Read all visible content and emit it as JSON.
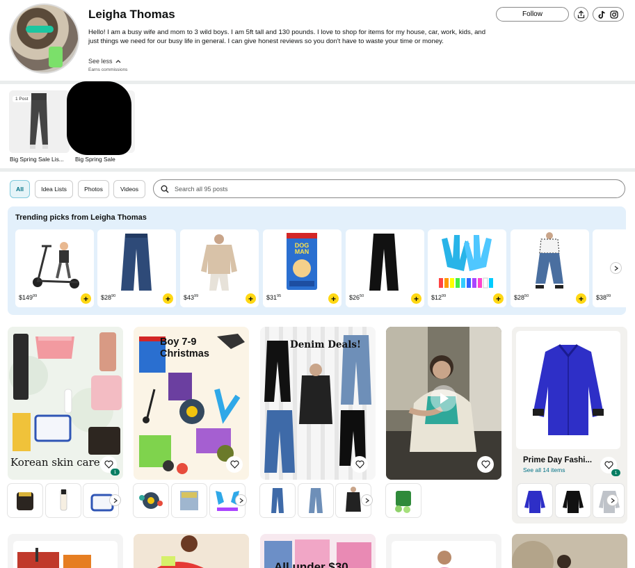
{
  "profile": {
    "name": "Leigha Thomas",
    "bio": "Hello! I am a busy wife and mom to 3 wild boys. I am 5ft tall and 130 pounds. I love to shop for items for my house, car, work, kids, and just things we need for our busy life in general. I can give honest reviews so you don't have to waste your time or money.",
    "see_less": "See less",
    "earns": "Earns commissions",
    "follow_label": "Follow"
  },
  "idea_lists": [
    {
      "label": "Big Spring Sale Lis...",
      "badge": "1 Post"
    },
    {
      "label": "Big Spring Sale",
      "badge": ""
    }
  ],
  "filters": {
    "chips": [
      "All",
      "Idea Lists",
      "Photos",
      "Videos"
    ],
    "active": "All",
    "search_placeholder": "Search all 95 posts"
  },
  "trending": {
    "title": "Trending picks from Leigha Thomas",
    "items": [
      {
        "dollars": "$149",
        "cents": "99",
        "icon": "electric-scooter"
      },
      {
        "dollars": "$28",
        "cents": "90",
        "icon": "wide-leg-jeans"
      },
      {
        "dollars": "$43",
        "cents": "99",
        "icon": "beige-sweater"
      },
      {
        "dollars": "$31",
        "cents": "95",
        "icon": "dog-man-book"
      },
      {
        "dollars": "$26",
        "cents": "50",
        "icon": "black-pants"
      },
      {
        "dollars": "$12",
        "cents": "99",
        "icon": "led-gloves"
      },
      {
        "dollars": "$28",
        "cents": "50",
        "icon": "cropped-jeans"
      },
      {
        "dollars": "$38",
        "cents": "99",
        "icon": "partial-item"
      }
    ]
  },
  "posts": [
    {
      "overlay": "Korean skin care",
      "count": "1"
    },
    {
      "overlay": "Boy 7-9 Christmas",
      "count": ""
    },
    {
      "overlay": "Denim Deals!",
      "count": ""
    },
    {
      "overlay": "",
      "count": ""
    },
    {
      "title": "Prime Day Fashi...",
      "subtitle": "See all 14 items",
      "count": "1"
    }
  ],
  "bottom_row": [
    {
      "overlay": ""
    },
    {
      "overlay": ""
    },
    {
      "overlay": "All under $30"
    },
    {
      "overlay": ""
    },
    {
      "overlay": ""
    }
  ]
}
